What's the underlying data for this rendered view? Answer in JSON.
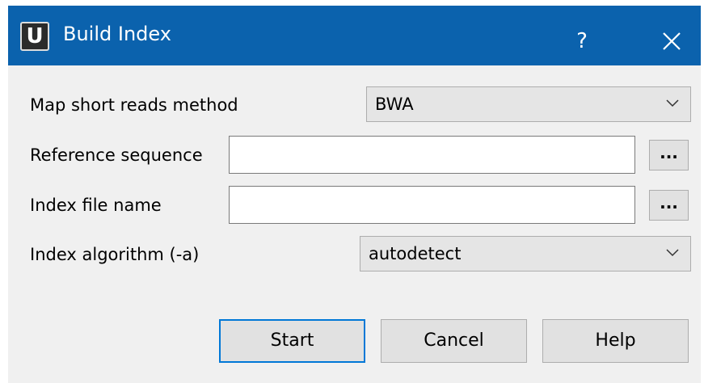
{
  "window": {
    "app_icon_letter": "U",
    "title": "Build Index",
    "help_glyph": "?"
  },
  "form": {
    "method": {
      "label": "Map short reads method",
      "value": "BWA"
    },
    "reference": {
      "label": "Reference sequence",
      "value": "",
      "browse_label": "..."
    },
    "index_file": {
      "label": "Index file name",
      "value": "",
      "browse_label": "..."
    },
    "algorithm": {
      "label": "Index algorithm (-a)",
      "value": "autodetect"
    }
  },
  "buttons": {
    "start": "Start",
    "cancel": "Cancel",
    "help": "Help"
  },
  "colors": {
    "titlebar": "#0b62ad",
    "default_button_border": "#0078d7",
    "dialog_background": "#f0f0f0"
  },
  "icons": {
    "app": "ugene-logo-icon",
    "close": "close-icon",
    "dropdown": "chevron-down-icon"
  }
}
